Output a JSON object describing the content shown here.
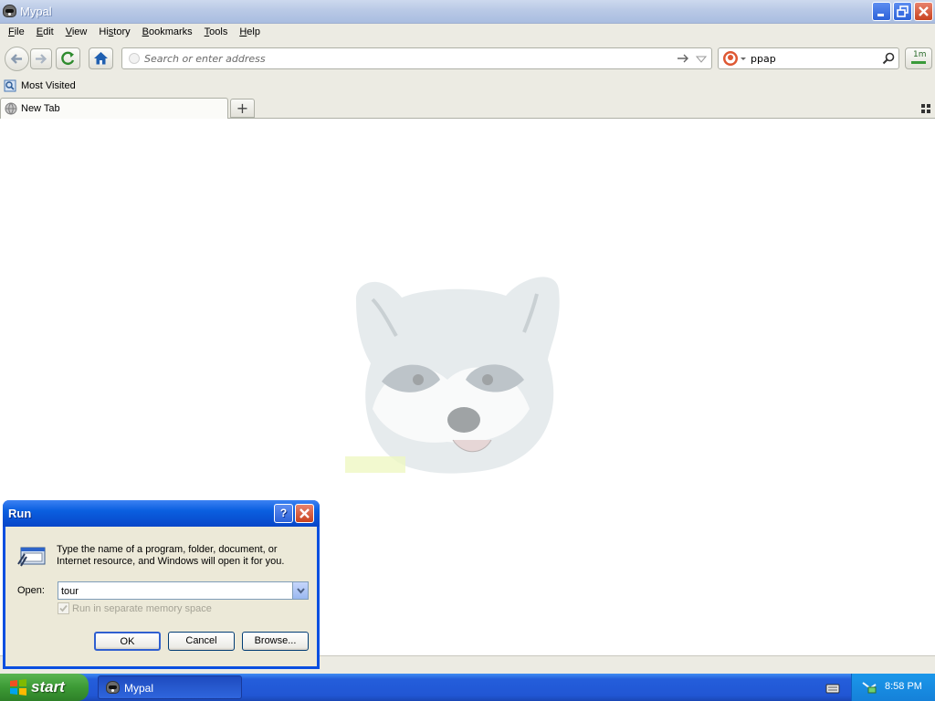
{
  "window": {
    "title": "Mypal",
    "controls": {
      "minimize": "minimize-icon",
      "restore": "restore-icon",
      "close": "close-icon"
    }
  },
  "menu": {
    "items": [
      {
        "label": "File",
        "u": "F",
        "rest": "ile"
      },
      {
        "label": "Edit",
        "u": "E",
        "rest": "dit"
      },
      {
        "label": "View",
        "u": "V",
        "rest": "iew"
      },
      {
        "label": "History",
        "pre": "Hi",
        "u": "s",
        "rest": "tory"
      },
      {
        "label": "Bookmarks",
        "u": "B",
        "rest": "ookmarks"
      },
      {
        "label": "Tools",
        "u": "T",
        "rest": "ools"
      },
      {
        "label": "Help",
        "u": "H",
        "rest": "elp"
      }
    ]
  },
  "toolbar": {
    "address_placeholder": "Search or enter address",
    "search_value": "ppap",
    "addon_button_label": "1m"
  },
  "bookmarks": {
    "most_visited": "Most Visited"
  },
  "tabs": [
    {
      "label": "New Tab"
    }
  ],
  "taskbar": {
    "start_label": "start",
    "task_mypal": "Mypal",
    "clock": "8:58 PM"
  },
  "run_dialog": {
    "title": "Run",
    "description": "Type the name of a program, folder, document, or Internet resource, and Windows will open it for you.",
    "open_label": "Open:",
    "open_value": "tour",
    "checkbox_label": "Run in separate memory space",
    "checkbox_checked": true,
    "buttons": {
      "ok": "OK",
      "cancel": "Cancel",
      "browse": "Browse..."
    }
  },
  "colors": {
    "taskbar_blue": "#245edb",
    "start_green": "#3c9a35",
    "dialog_border": "#0a4fe0",
    "chrome_bg": "#ecebe3"
  }
}
